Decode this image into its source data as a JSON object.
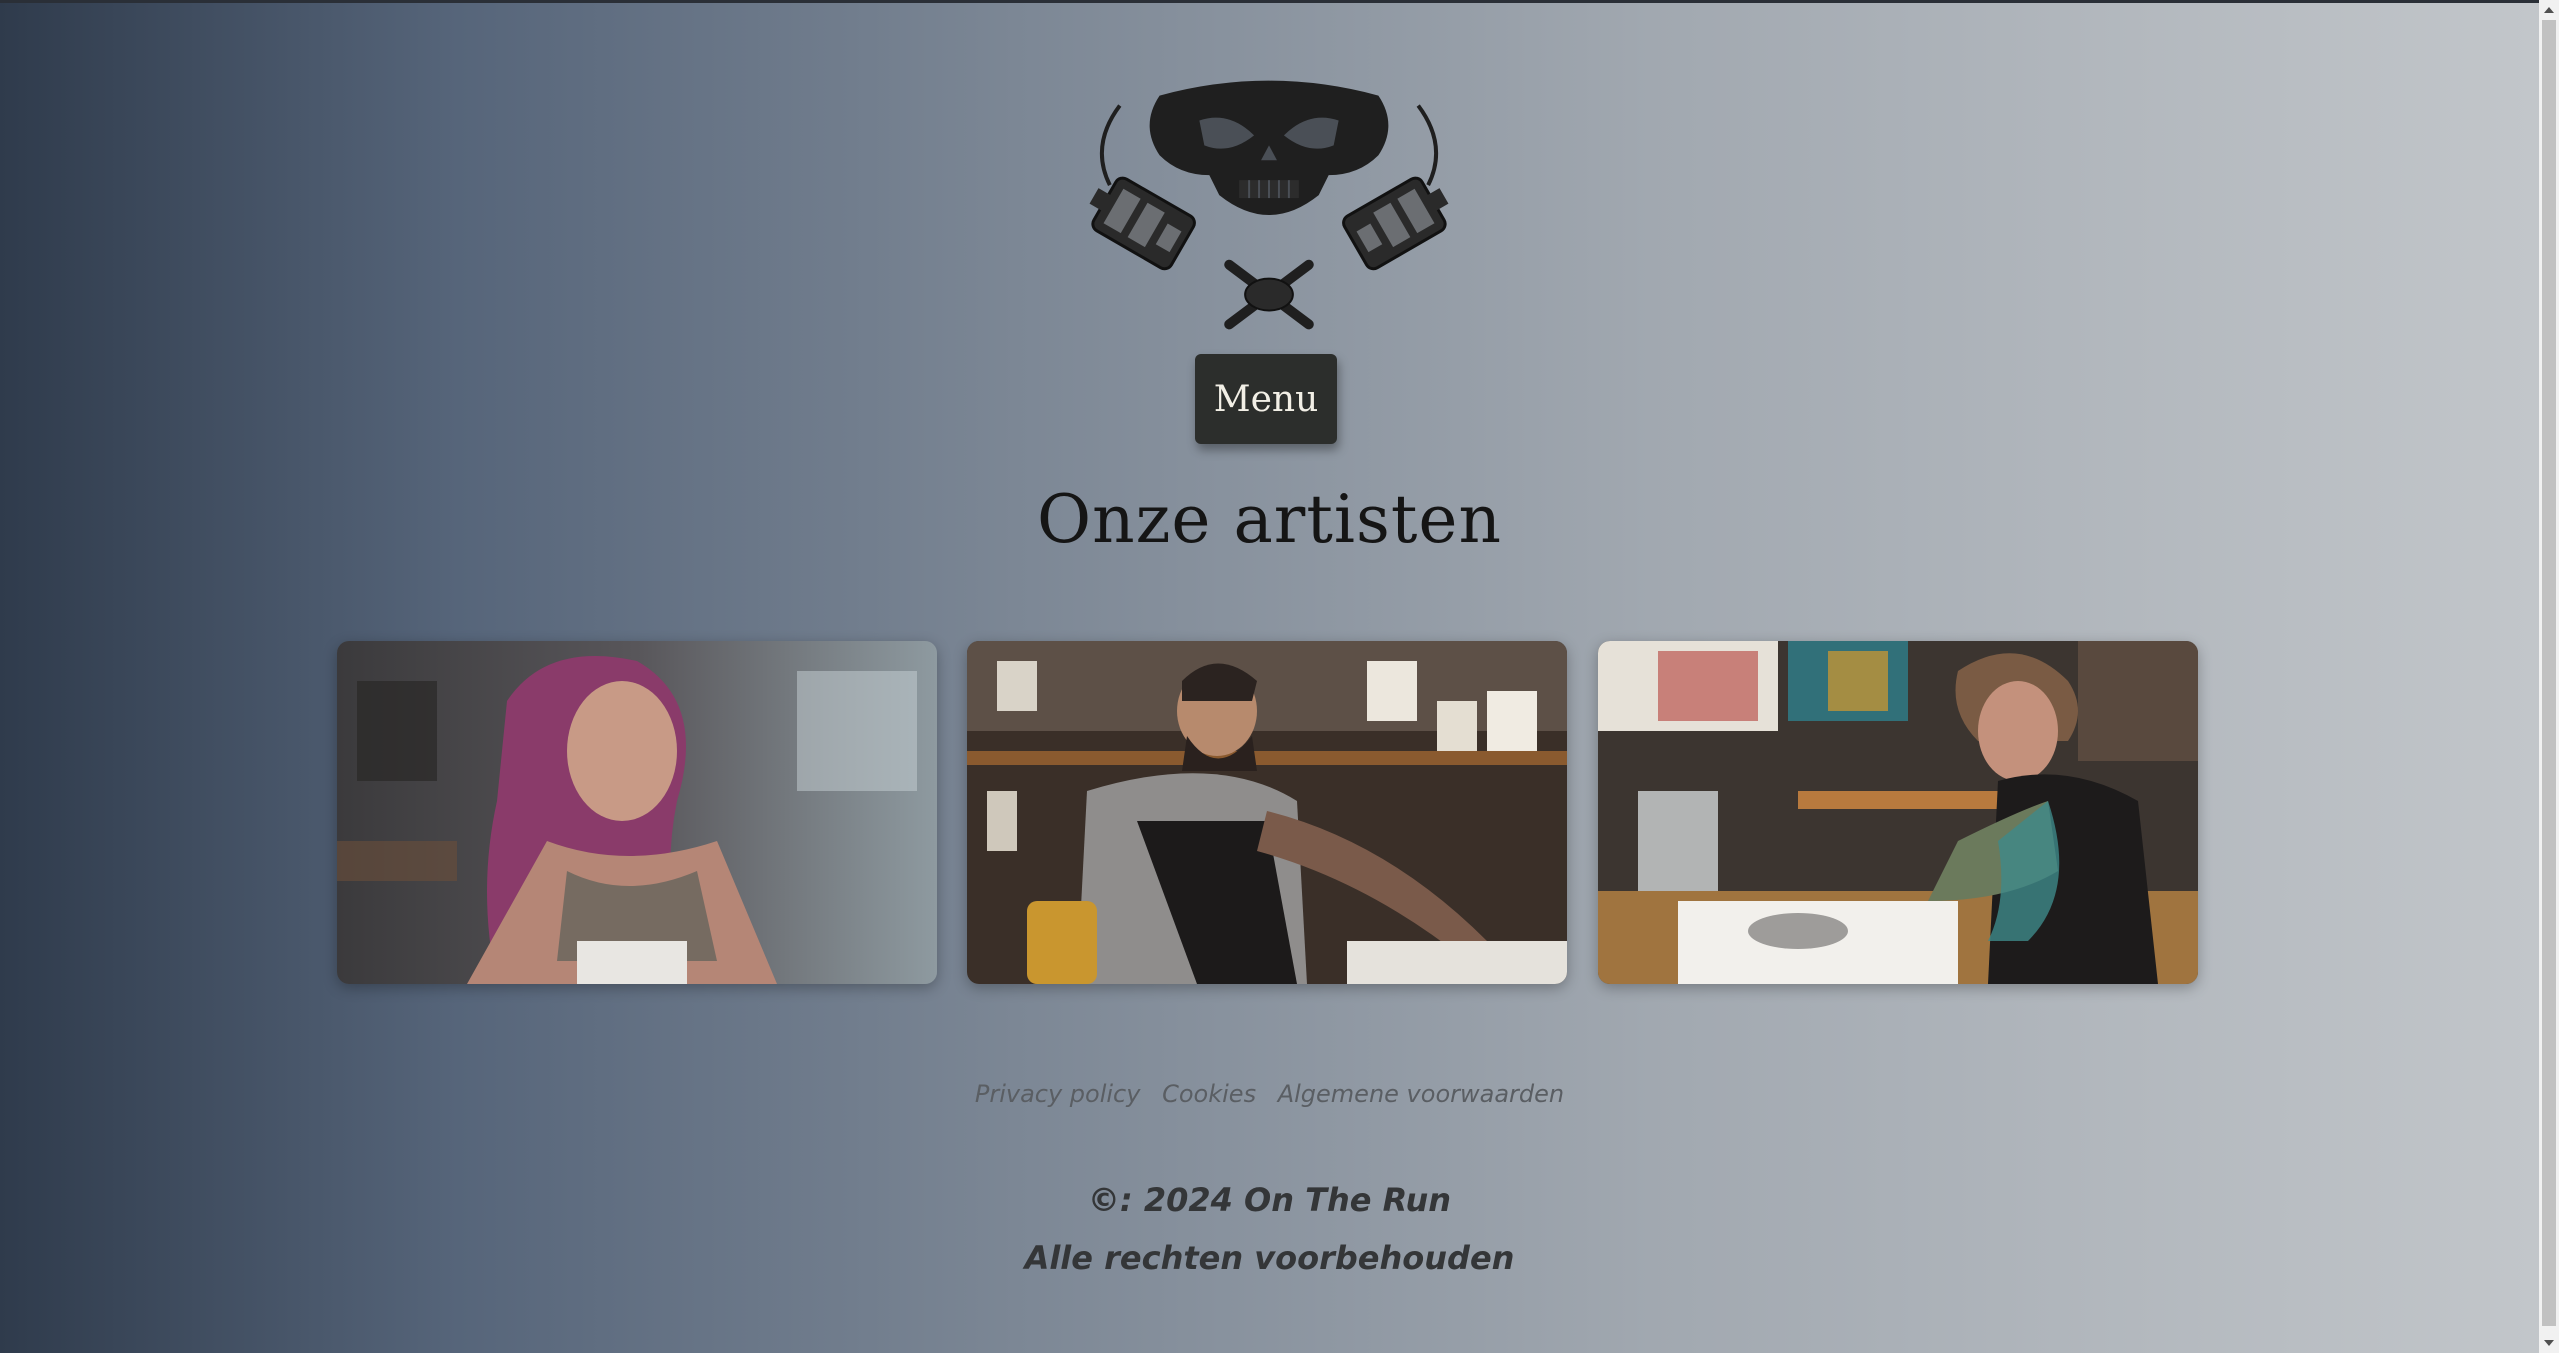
{
  "header": {
    "logo_icon": "skull-tattoo-machines-logo",
    "menu_label": "Menu"
  },
  "main": {
    "title": "Onze artisten",
    "artists": [
      {
        "image": "artist-photo-woman-pink-hair"
      },
      {
        "image": "artist-photo-man-tattooing"
      },
      {
        "image": "artist-photo-woman-drawing"
      }
    ]
  },
  "footer": {
    "links": [
      "Privacy policy",
      "Cookies",
      "Algemene voorwaarden"
    ],
    "copyright": "©: 2024 On The Run",
    "rights": "Alle rechten voorbehouden"
  },
  "colors": {
    "gradient_start": "#2f3b4c",
    "gradient_end": "#c2c6ca",
    "menu_bg": "#2c2e2c",
    "menu_text": "#f2efe6"
  }
}
